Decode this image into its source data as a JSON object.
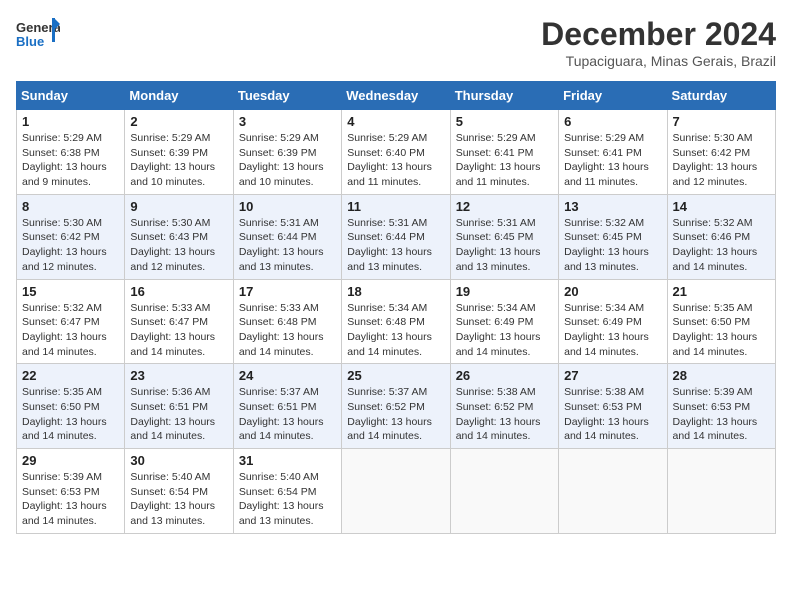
{
  "header": {
    "logo_general": "General",
    "logo_blue": "Blue",
    "month_title": "December 2024",
    "location": "Tupaciguara, Minas Gerais, Brazil"
  },
  "weekdays": [
    "Sunday",
    "Monday",
    "Tuesday",
    "Wednesday",
    "Thursday",
    "Friday",
    "Saturday"
  ],
  "weeks": [
    [
      {
        "day": "1",
        "sunrise": "5:29 AM",
        "sunset": "6:38 PM",
        "daylight": "13 hours and 9 minutes."
      },
      {
        "day": "2",
        "sunrise": "5:29 AM",
        "sunset": "6:39 PM",
        "daylight": "13 hours and 10 minutes."
      },
      {
        "day": "3",
        "sunrise": "5:29 AM",
        "sunset": "6:39 PM",
        "daylight": "13 hours and 10 minutes."
      },
      {
        "day": "4",
        "sunrise": "5:29 AM",
        "sunset": "6:40 PM",
        "daylight": "13 hours and 11 minutes."
      },
      {
        "day": "5",
        "sunrise": "5:29 AM",
        "sunset": "6:41 PM",
        "daylight": "13 hours and 11 minutes."
      },
      {
        "day": "6",
        "sunrise": "5:29 AM",
        "sunset": "6:41 PM",
        "daylight": "13 hours and 11 minutes."
      },
      {
        "day": "7",
        "sunrise": "5:30 AM",
        "sunset": "6:42 PM",
        "daylight": "13 hours and 12 minutes."
      }
    ],
    [
      {
        "day": "8",
        "sunrise": "5:30 AM",
        "sunset": "6:42 PM",
        "daylight": "13 hours and 12 minutes."
      },
      {
        "day": "9",
        "sunrise": "5:30 AM",
        "sunset": "6:43 PM",
        "daylight": "13 hours and 12 minutes."
      },
      {
        "day": "10",
        "sunrise": "5:31 AM",
        "sunset": "6:44 PM",
        "daylight": "13 hours and 13 minutes."
      },
      {
        "day": "11",
        "sunrise": "5:31 AM",
        "sunset": "6:44 PM",
        "daylight": "13 hours and 13 minutes."
      },
      {
        "day": "12",
        "sunrise": "5:31 AM",
        "sunset": "6:45 PM",
        "daylight": "13 hours and 13 minutes."
      },
      {
        "day": "13",
        "sunrise": "5:32 AM",
        "sunset": "6:45 PM",
        "daylight": "13 hours and 13 minutes."
      },
      {
        "day": "14",
        "sunrise": "5:32 AM",
        "sunset": "6:46 PM",
        "daylight": "13 hours and 14 minutes."
      }
    ],
    [
      {
        "day": "15",
        "sunrise": "5:32 AM",
        "sunset": "6:47 PM",
        "daylight": "13 hours and 14 minutes."
      },
      {
        "day": "16",
        "sunrise": "5:33 AM",
        "sunset": "6:47 PM",
        "daylight": "13 hours and 14 minutes."
      },
      {
        "day": "17",
        "sunrise": "5:33 AM",
        "sunset": "6:48 PM",
        "daylight": "13 hours and 14 minutes."
      },
      {
        "day": "18",
        "sunrise": "5:34 AM",
        "sunset": "6:48 PM",
        "daylight": "13 hours and 14 minutes."
      },
      {
        "day": "19",
        "sunrise": "5:34 AM",
        "sunset": "6:49 PM",
        "daylight": "13 hours and 14 minutes."
      },
      {
        "day": "20",
        "sunrise": "5:34 AM",
        "sunset": "6:49 PM",
        "daylight": "13 hours and 14 minutes."
      },
      {
        "day": "21",
        "sunrise": "5:35 AM",
        "sunset": "6:50 PM",
        "daylight": "13 hours and 14 minutes."
      }
    ],
    [
      {
        "day": "22",
        "sunrise": "5:35 AM",
        "sunset": "6:50 PM",
        "daylight": "13 hours and 14 minutes."
      },
      {
        "day": "23",
        "sunrise": "5:36 AM",
        "sunset": "6:51 PM",
        "daylight": "13 hours and 14 minutes."
      },
      {
        "day": "24",
        "sunrise": "5:37 AM",
        "sunset": "6:51 PM",
        "daylight": "13 hours and 14 minutes."
      },
      {
        "day": "25",
        "sunrise": "5:37 AM",
        "sunset": "6:52 PM",
        "daylight": "13 hours and 14 minutes."
      },
      {
        "day": "26",
        "sunrise": "5:38 AM",
        "sunset": "6:52 PM",
        "daylight": "13 hours and 14 minutes."
      },
      {
        "day": "27",
        "sunrise": "5:38 AM",
        "sunset": "6:53 PM",
        "daylight": "13 hours and 14 minutes."
      },
      {
        "day": "28",
        "sunrise": "5:39 AM",
        "sunset": "6:53 PM",
        "daylight": "13 hours and 14 minutes."
      }
    ],
    [
      {
        "day": "29",
        "sunrise": "5:39 AM",
        "sunset": "6:53 PM",
        "daylight": "13 hours and 14 minutes."
      },
      {
        "day": "30",
        "sunrise": "5:40 AM",
        "sunset": "6:54 PM",
        "daylight": "13 hours and 13 minutes."
      },
      {
        "day": "31",
        "sunrise": "5:40 AM",
        "sunset": "6:54 PM",
        "daylight": "13 hours and 13 minutes."
      },
      null,
      null,
      null,
      null
    ]
  ]
}
